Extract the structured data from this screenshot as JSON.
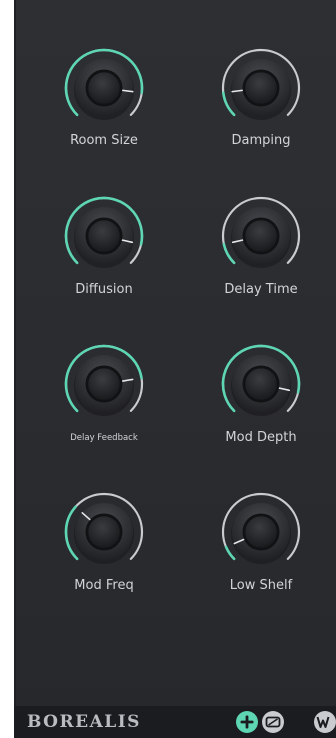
{
  "brand": "BOREALIS",
  "colors": {
    "accent": "#5ed6b3",
    "track": "#c9cbcf",
    "panel": "#2b2d31",
    "footer": "#1b1c1f"
  },
  "knobs": [
    {
      "label": "Room Size",
      "value": 0.86
    },
    {
      "label": "Damping",
      "value": 0.14
    },
    {
      "label": "Diffusion",
      "value": 0.88
    },
    {
      "label": "Delay Time",
      "value": 0.12
    },
    {
      "label": "Delay Feedback",
      "value": 0.8
    },
    {
      "label": "Mod Depth",
      "value": 0.88
    },
    {
      "label": "Mod Freq",
      "value": 0.32
    },
    {
      "label": "Low Shelf",
      "value": 0.08
    }
  ],
  "footer_icons": [
    {
      "name": "add-icon"
    },
    {
      "name": "preset-icon"
    },
    {
      "name": "w-icon"
    }
  ]
}
